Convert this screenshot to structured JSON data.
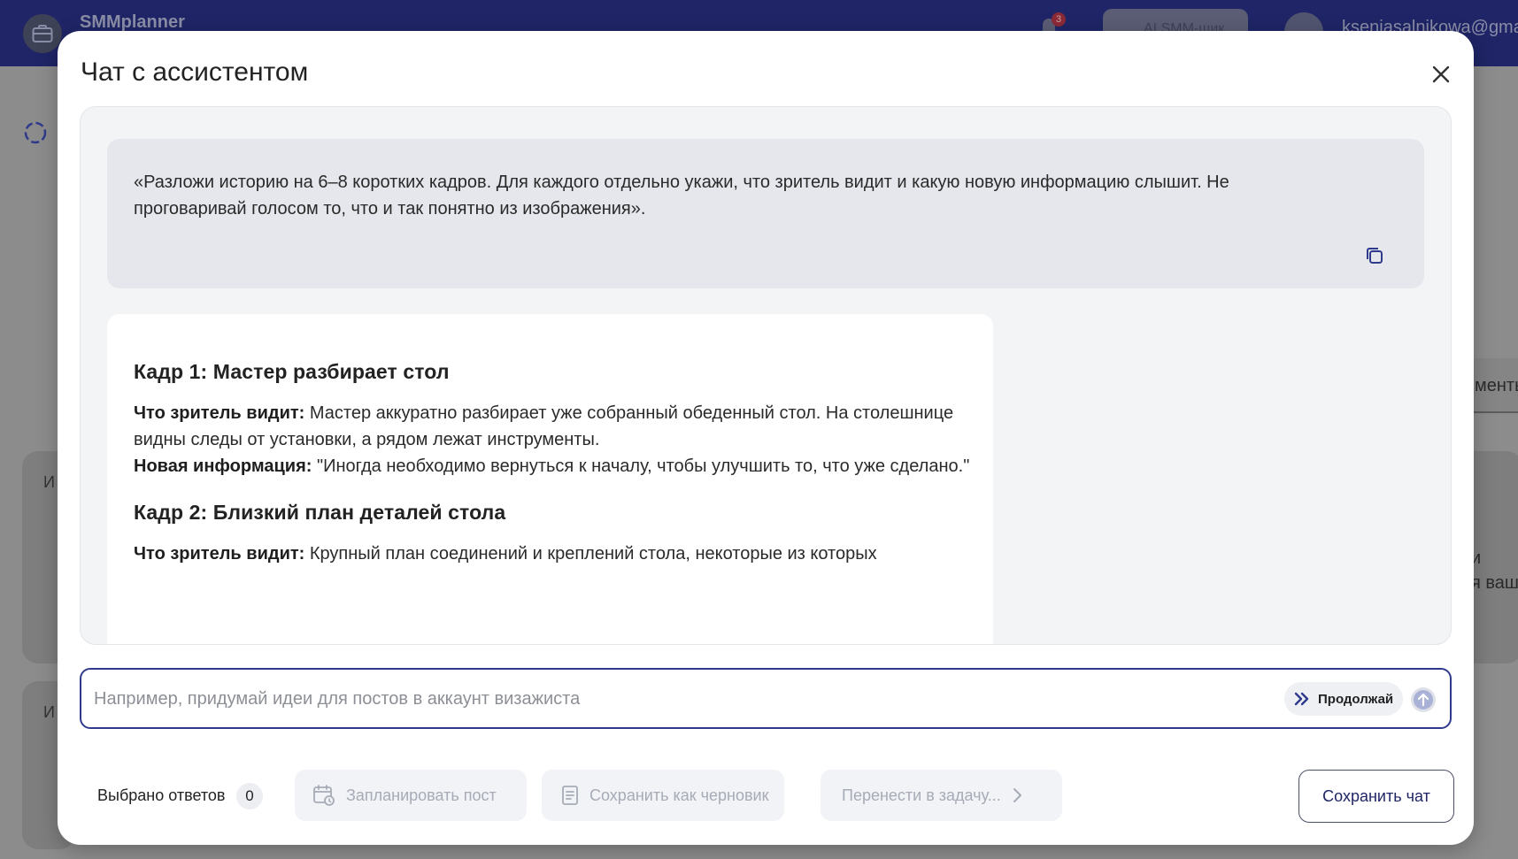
{
  "app": {
    "name": "SMMplanner",
    "notification_count": "3",
    "ai_button_label": "AI SMM-щик",
    "user_email": "kseniasalnikowa@gmail.com",
    "bg_right_tab_label": "менты",
    "bg_right_text_1": "и",
    "bg_right_text_2": "я ваш",
    "bg_card_letter": "И"
  },
  "modal": {
    "title": "Чат с ассистентом",
    "user_message": "«Разложи историю на 6–8 коротких кадров. Для каждого отдельно укажи, что зритель видит и какую новую информацию слышит. Не проговаривай голосом то, что и так понятно из изображения».",
    "assistant_message": {
      "frames": [
        {
          "heading": "Кадр 1: Мастер разбирает стол",
          "sees_label": "Что зритель видит:",
          "sees_text": " Мастер аккуратно разбирает уже собранный обеденный стол. На столешнице видны следы от установки, а рядом лежат инструменты.",
          "info_label": "Новая информация:",
          "info_text": " \"Иногда необходимо вернуться к началу, чтобы улучшить то, что уже сделано.\""
        },
        {
          "heading": "Кадр 2: Близкий план деталей стола",
          "sees_label": "Что зритель видит:",
          "sees_text": " Крупный план соединений и креплений стола, некоторые из которых"
        }
      ]
    },
    "input": {
      "placeholder": "Например, придумай идеи для постов в аккаунт визажиста",
      "value": ""
    },
    "continue_label": "Продолжай",
    "footer": {
      "selected_label": "Выбрано ответов",
      "selected_count": "0",
      "schedule_label": "Запланировать пост",
      "draft_label": "Сохранить как черновик",
      "task_label": "Перенести в задачу...",
      "save_chat_label": "Сохранить чат"
    }
  }
}
